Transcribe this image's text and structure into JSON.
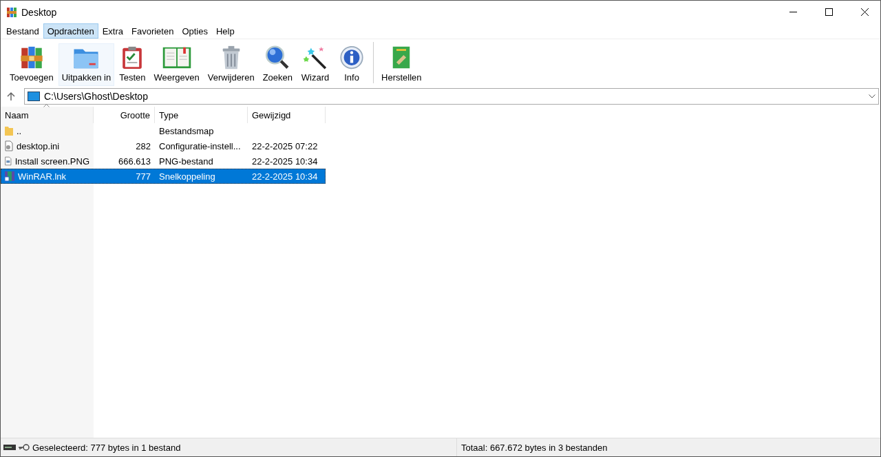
{
  "window": {
    "title": "Desktop"
  },
  "menu": [
    {
      "label": "Bestand",
      "selected": false
    },
    {
      "label": "Opdrachten",
      "selected": true
    },
    {
      "label": "Extra",
      "selected": false
    },
    {
      "label": "Favorieten",
      "selected": false
    },
    {
      "label": "Opties",
      "selected": false
    },
    {
      "label": "Help",
      "selected": false
    }
  ],
  "toolbar": [
    {
      "label": "Toevoegen",
      "kind": "books",
      "highlighted": false
    },
    {
      "label": "Uitpakken in",
      "kind": "folder",
      "highlighted": true
    },
    {
      "label": "Testen",
      "kind": "clipboard",
      "highlighted": false
    },
    {
      "label": "Weergeven",
      "kind": "book",
      "highlighted": false
    },
    {
      "label": "Verwijderen",
      "kind": "trash",
      "highlighted": false
    },
    {
      "label": "Zoeken",
      "kind": "magnifier",
      "highlighted": false
    },
    {
      "label": "Wizard",
      "kind": "wand",
      "highlighted": false
    },
    {
      "label": "Info",
      "kind": "info",
      "highlighted": false
    },
    {
      "label": "Herstellen",
      "kind": "repair",
      "highlighted": false,
      "separated": true
    }
  ],
  "address": {
    "value": "C:\\Users\\Ghost\\Desktop"
  },
  "table": {
    "columns": [
      "Naam",
      "Grootte",
      "Type",
      "Gewijzigd"
    ],
    "rows": [
      {
        "kind": "folder",
        "name": "..",
        "size": "",
        "type": "Bestandsmap",
        "modified": "",
        "selected": false
      },
      {
        "kind": "settings",
        "name": "desktop.ini",
        "size": "282",
        "type": "Configuratie-instell...",
        "modified": "22-2-2025 07:22",
        "selected": false
      },
      {
        "kind": "image",
        "name": "Install screen.PNG",
        "size": "666.613",
        "type": "PNG-bestand",
        "modified": "22-2-2025 10:34",
        "selected": false
      },
      {
        "kind": "shortcut",
        "name": "WinRAR.lnk",
        "size": "777",
        "type": "Snelkoppeling",
        "modified": "22-2-2025 10:34",
        "selected": true
      }
    ]
  },
  "status_bar": {
    "selected": "Geselecteerd: 777 bytes in 1 bestand",
    "total": "Totaal: 667.672 bytes in 3 bestanden"
  }
}
